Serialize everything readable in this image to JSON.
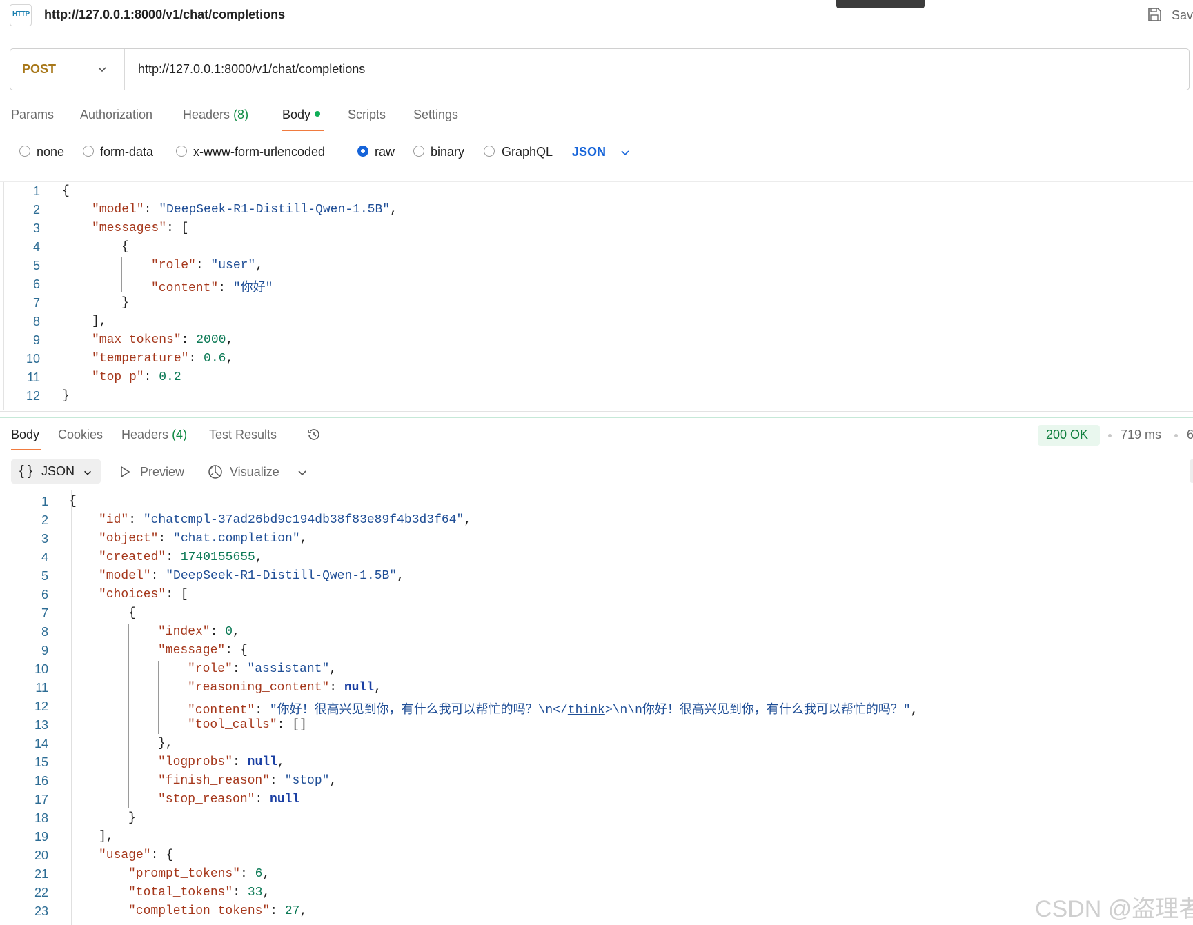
{
  "header": {
    "icon_label": "HTTP",
    "title": "http://127.0.0.1:8000/v1/chat/completions",
    "save_label": "Sav"
  },
  "request": {
    "method": "POST",
    "url": "http://127.0.0.1:8000/v1/chat/completions"
  },
  "tabs": {
    "params": "Params",
    "authorization": "Authorization",
    "headers": "Headers",
    "headers_count": "(8)",
    "body": "Body",
    "scripts": "Scripts",
    "settings": "Settings"
  },
  "body_types": {
    "none": "none",
    "form_data": "form-data",
    "urlencoded": "x-www-form-urlencoded",
    "raw": "raw",
    "binary": "binary",
    "graphql": "GraphQL",
    "selected_format": "JSON"
  },
  "request_body": {
    "line_numbers": [
      "1",
      "2",
      "3",
      "4",
      "5",
      "6",
      "7",
      "8",
      "9",
      "10",
      "11",
      "12"
    ],
    "model": "\"DeepSeek-R1-Distill-Qwen-1.5B\"",
    "role": "\"user\"",
    "content": "\"你好\"",
    "max_tokens": "2000",
    "temperature": "0.6",
    "top_p": "0.2"
  },
  "response_tabs": {
    "body": "Body",
    "cookies": "Cookies",
    "headers": "Headers",
    "headers_count": "(4)",
    "test_results": "Test Results"
  },
  "response_meta": {
    "status": "200 OK",
    "time": "719 ms",
    "size_partial": "6"
  },
  "response_format": {
    "braces": "{ }",
    "format": "JSON",
    "preview": "Preview",
    "visualize": "Visualize"
  },
  "response_body": {
    "line_numbers": [
      "1",
      "2",
      "3",
      "4",
      "5",
      "6",
      "7",
      "8",
      "9",
      "10",
      "11",
      "12",
      "13",
      "14",
      "15",
      "16",
      "17",
      "18",
      "19",
      "20",
      "21",
      "22",
      "23"
    ],
    "id": "\"chatcmpl-37ad26bd9c194db38f83e89f4b3d3f64\"",
    "object": "\"chat.completion\"",
    "created": "1740155655",
    "model": "\"DeepSeek-R1-Distill-Qwen-1.5B\"",
    "index": "0",
    "role": "\"assistant\"",
    "reasoning_content": "null",
    "content_start": "\"你好！很高兴见到你，有什么我可以帮忙的吗？\\n</",
    "content_think": "think",
    "content_end": ">\\n\\n你好！很高兴见到你，有什么我可以帮忙的吗？\"",
    "tool_calls": "[]",
    "logprobs": "null",
    "finish_reason": "\"stop\"",
    "stop_reason": "null",
    "prompt_tokens": "6",
    "total_tokens": "33",
    "completion_tokens": "27"
  },
  "watermark": "CSDN @盗理者"
}
